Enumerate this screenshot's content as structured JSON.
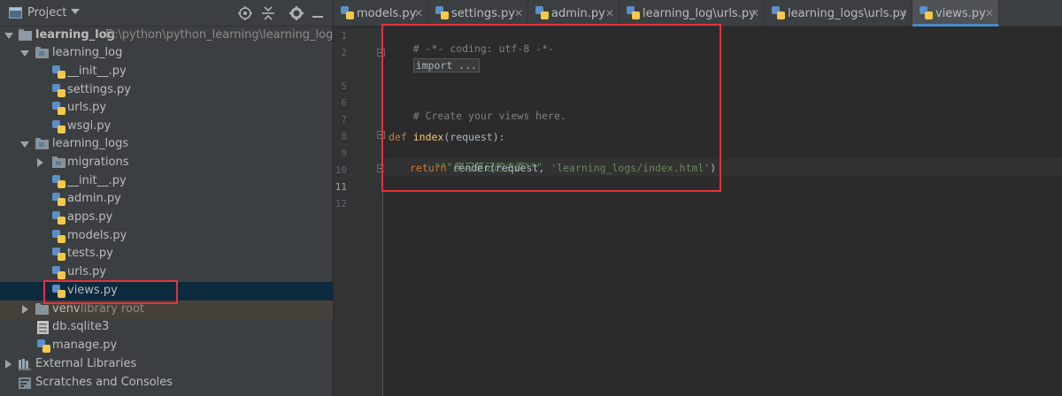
{
  "project_panel": {
    "title": "Project",
    "tools": [
      "locate-icon",
      "collapse-icon",
      "gear-icon",
      "hide-icon"
    ],
    "tree": [
      {
        "label": "learning_log",
        "sub": "D:\\python\\python_learning\\learning_log",
        "type": "root-folder",
        "depth": 0,
        "expanded": true
      },
      {
        "label": "learning_log",
        "type": "package",
        "depth": 1,
        "expanded": true
      },
      {
        "label": "__init__.py",
        "type": "py",
        "depth": 2
      },
      {
        "label": "settings.py",
        "type": "py",
        "depth": 2
      },
      {
        "label": "urls.py",
        "type": "py",
        "depth": 2
      },
      {
        "label": "wsgi.py",
        "type": "py",
        "depth": 2
      },
      {
        "label": "learning_logs",
        "type": "package",
        "depth": 1,
        "expanded": true
      },
      {
        "label": "migrations",
        "type": "package",
        "depth": 2,
        "expanded": false
      },
      {
        "label": "__init__.py",
        "type": "py",
        "depth": 2
      },
      {
        "label": "admin.py",
        "type": "py",
        "depth": 2
      },
      {
        "label": "apps.py",
        "type": "py",
        "depth": 2
      },
      {
        "label": "models.py",
        "type": "py",
        "depth": 2
      },
      {
        "label": "tests.py",
        "type": "py",
        "depth": 2
      },
      {
        "label": "urls.py",
        "type": "py",
        "depth": 2
      },
      {
        "label": "views.py",
        "type": "py",
        "depth": 2,
        "selected": true
      },
      {
        "label": "venv",
        "sub": "library root",
        "type": "folder",
        "depth": 1,
        "expanded": false
      },
      {
        "label": "db.sqlite3",
        "type": "db",
        "depth": 1
      },
      {
        "label": "manage.py",
        "type": "py",
        "depth": 1
      },
      {
        "label": "External Libraries",
        "type": "lib",
        "depth": 0,
        "expanded": false
      },
      {
        "label": "Scratches and Consoles",
        "type": "scratch",
        "depth": 0
      }
    ]
  },
  "tabs": [
    {
      "label": "models.py"
    },
    {
      "label": "settings.py"
    },
    {
      "label": "admin.py"
    },
    {
      "label": "learning_log\\urls.py"
    },
    {
      "label": "learning_logs\\urls.py"
    },
    {
      "label": "views.py",
      "active": true
    }
  ],
  "editor": {
    "current_line": "11",
    "line_numbers": [
      "1",
      "2",
      "5",
      "6",
      "7",
      "8",
      "9",
      "10",
      "11",
      "12"
    ],
    "code": {
      "l1": "# -*- coding: utf-8 -*-",
      "l2": "import ...",
      "l7": "# Create your views here.",
      "l9_kw": "def",
      "l9_fn": "index",
      "l9_rest": "(request):",
      "l10": "\"\"\"学习笔记的主页\"\"\"",
      "l11_kw": "return",
      "l11_a": " render(request, ",
      "l11_str": "'learning_logs/index.html'",
      "l11_b": ")"
    }
  },
  "colors": {
    "accent": "#4a88c7",
    "annotation": "#e5323b",
    "selection": "#0d293e"
  }
}
